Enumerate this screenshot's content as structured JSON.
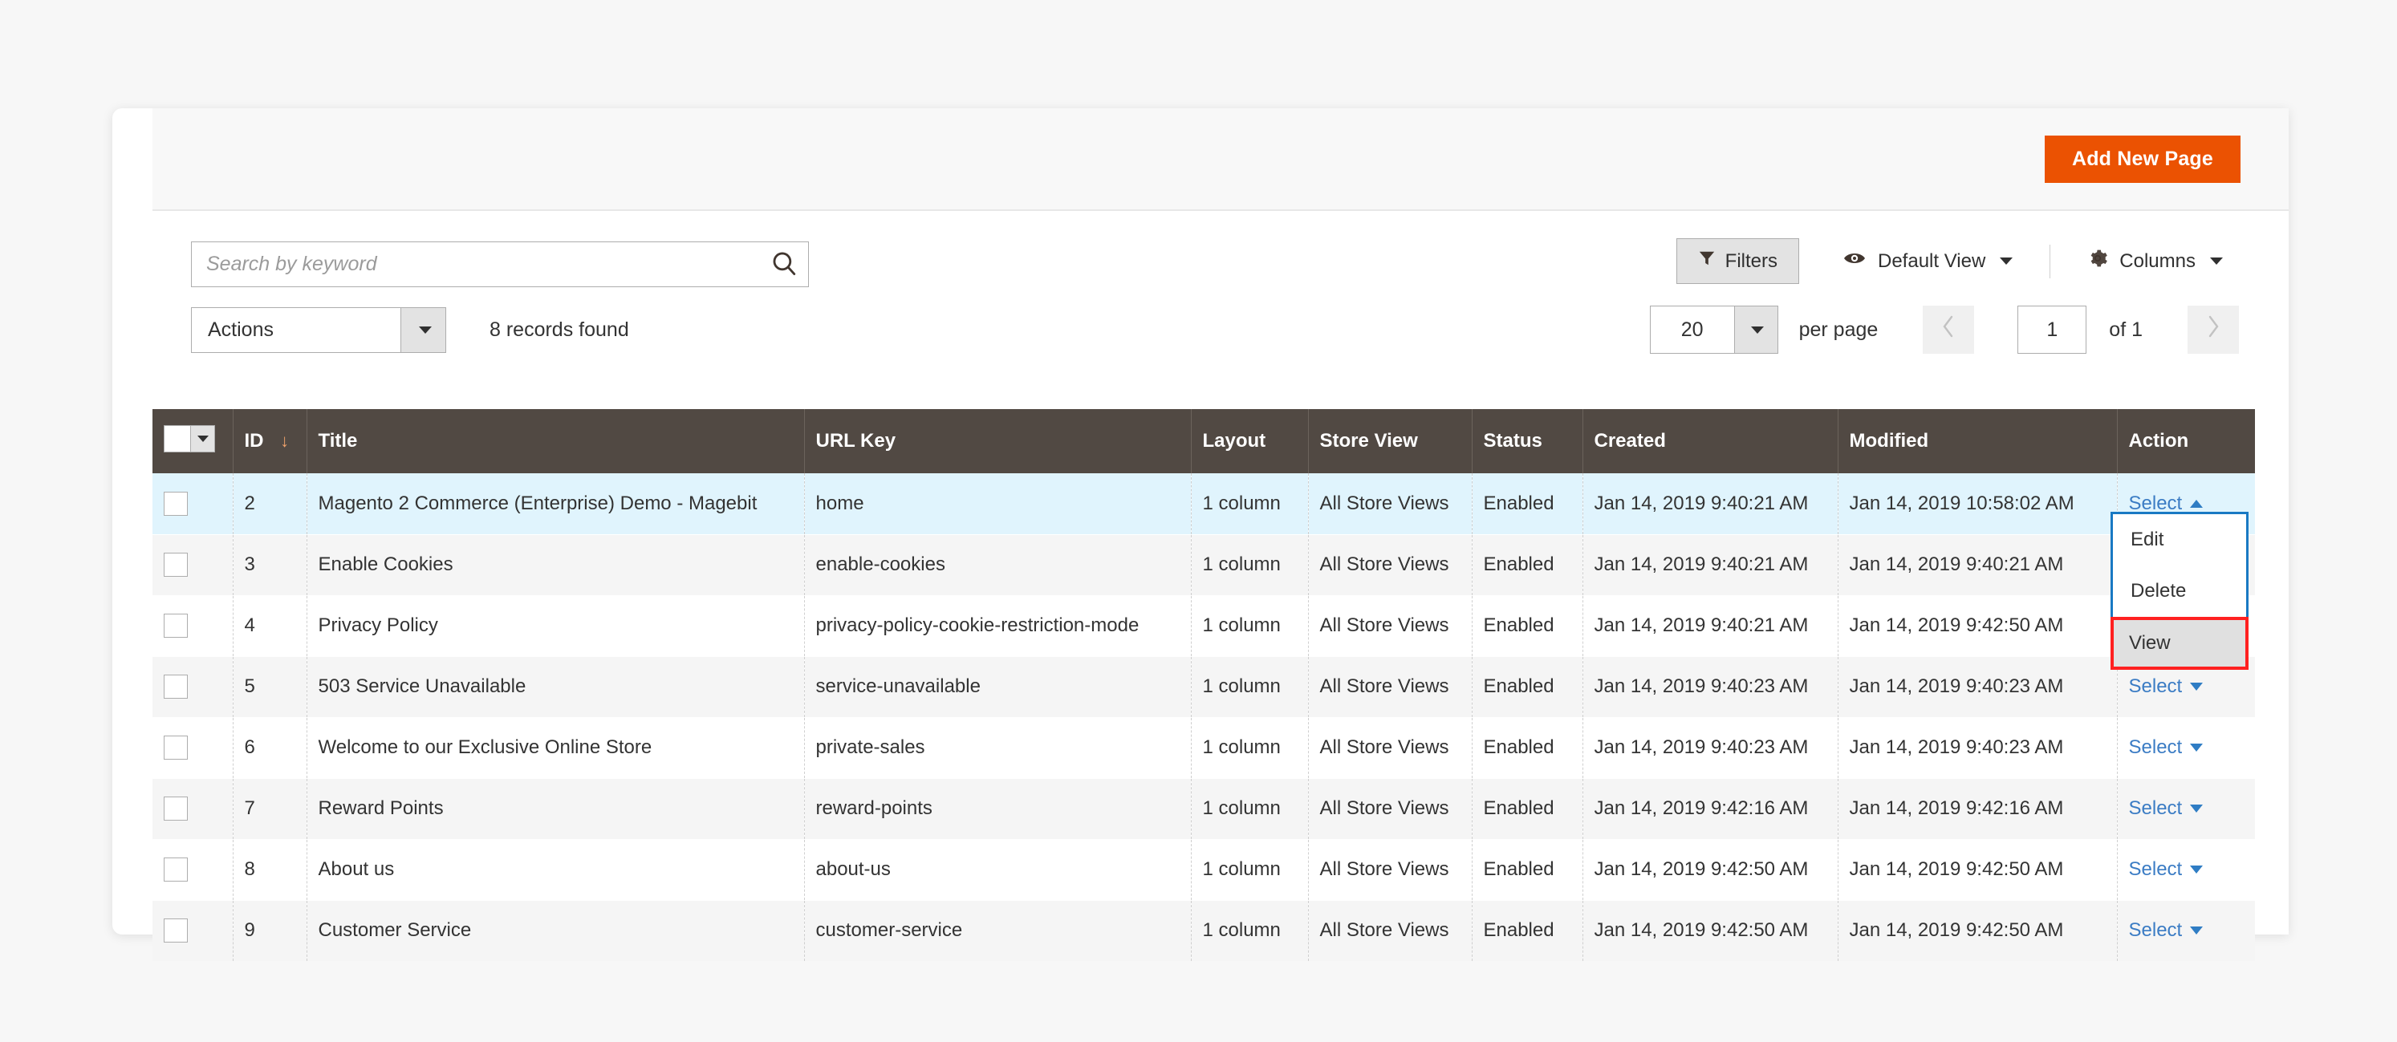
{
  "header": {
    "add_new_page_label": "Add New Page"
  },
  "search": {
    "placeholder": "Search by keyword",
    "value": "",
    "icon": "search-icon"
  },
  "view_controls": {
    "filters_label": "Filters",
    "filters_icon": "funnel-icon",
    "default_view_label": "Default View",
    "default_view_icon": "eye-icon",
    "columns_label": "Columns",
    "columns_icon": "gear-icon"
  },
  "actions": {
    "label": "Actions",
    "records_found": "8 records found"
  },
  "pager": {
    "per_page_value": "20",
    "per_page_label": "per page",
    "prev_icon": "chevron-left-icon",
    "next_icon": "chevron-right-icon",
    "current_page": "1",
    "of_label": "of 1"
  },
  "grid": {
    "columns": [
      {
        "key": "checkbox",
        "label": ""
      },
      {
        "key": "id",
        "label": "ID",
        "sort": "asc"
      },
      {
        "key": "title",
        "label": "Title"
      },
      {
        "key": "url_key",
        "label": "URL Key"
      },
      {
        "key": "layout",
        "label": "Layout"
      },
      {
        "key": "store_view",
        "label": "Store View"
      },
      {
        "key": "status",
        "label": "Status"
      },
      {
        "key": "created",
        "label": "Created"
      },
      {
        "key": "modified",
        "label": "Modified"
      },
      {
        "key": "action",
        "label": "Action"
      }
    ],
    "action_link_label": "Select",
    "rows": [
      {
        "id": "2",
        "title": "Magento 2 Commerce (Enterprise) Demo - Magebit",
        "url_key": "home",
        "layout": "1 column",
        "store_view": "All Store Views",
        "status": "Enabled",
        "created": "Jan 14, 2019 9:40:21 AM",
        "modified": "Jan 14, 2019 10:58:02 AM",
        "highlighted": true,
        "menu_open": true
      },
      {
        "id": "3",
        "title": "Enable Cookies",
        "url_key": "enable-cookies",
        "layout": "1 column",
        "store_view": "All Store Views",
        "status": "Enabled",
        "created": "Jan 14, 2019 9:40:21 AM",
        "modified": "Jan 14, 2019 9:40:21 AM"
      },
      {
        "id": "4",
        "title": "Privacy Policy",
        "url_key": "privacy-policy-cookie-restriction-mode",
        "layout": "1 column",
        "store_view": "All Store Views",
        "status": "Enabled",
        "created": "Jan 14, 2019 9:40:21 AM",
        "modified": "Jan 14, 2019 9:42:50 AM"
      },
      {
        "id": "5",
        "title": "503 Service Unavailable",
        "url_key": "service-unavailable",
        "layout": "1 column",
        "store_view": "All Store Views",
        "status": "Enabled",
        "created": "Jan 14, 2019 9:40:23 AM",
        "modified": "Jan 14, 2019 9:40:23 AM"
      },
      {
        "id": "6",
        "title": "Welcome to our Exclusive Online Store",
        "url_key": "private-sales",
        "layout": "1 column",
        "store_view": "All Store Views",
        "status": "Enabled",
        "created": "Jan 14, 2019 9:40:23 AM",
        "modified": "Jan 14, 2019 9:40:23 AM"
      },
      {
        "id": "7",
        "title": "Reward Points",
        "url_key": "reward-points",
        "layout": "1 column",
        "store_view": "All Store Views",
        "status": "Enabled",
        "created": "Jan 14, 2019 9:42:16 AM",
        "modified": "Jan 14, 2019 9:42:16 AM"
      },
      {
        "id": "8",
        "title": "About us",
        "url_key": "about-us",
        "layout": "1 column",
        "store_view": "All Store Views",
        "status": "Enabled",
        "created": "Jan 14, 2019 9:42:50 AM",
        "modified": "Jan 14, 2019 9:42:50 AM"
      },
      {
        "id": "9",
        "title": "Customer Service",
        "url_key": "customer-service",
        "layout": "1 column",
        "store_view": "All Store Views",
        "status": "Enabled",
        "created": "Jan 14, 2019 9:42:50 AM",
        "modified": "Jan 14, 2019 9:42:50 AM"
      }
    ]
  },
  "action_menu": {
    "items": [
      {
        "label": "Edit",
        "highlighted": false
      },
      {
        "label": "Delete",
        "highlighted": false
      },
      {
        "label": "View",
        "highlighted": true
      }
    ]
  },
  "colors": {
    "accent_orange": "#eb5202",
    "grid_header": "#514943",
    "link_blue": "#3b7cc4",
    "menu_border_blue": "#1979c3",
    "highlight_red": "#ff2020",
    "row_highlight": "#e0f4fd"
  }
}
